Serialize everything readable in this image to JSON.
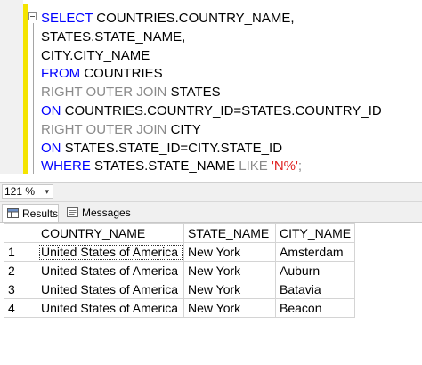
{
  "editor": {
    "lines": [
      [
        {
          "t": "SELECT COUNTRIES.COUNTRY_NAME,",
          "c": "kw-mixed"
        }
      ],
      [
        {
          "t": "STATES.STATE_NAME,",
          "c": ""
        }
      ],
      [
        {
          "t": "CITY.CITY_NAME",
          "c": ""
        }
      ],
      [
        {
          "t": "FROM",
          "c": "kw"
        },
        {
          "t": " COUNTRIES",
          "c": ""
        }
      ],
      [
        {
          "t": "RIGHT OUTER JOIN",
          "c": "gr"
        },
        {
          "t": " STATES",
          "c": ""
        }
      ],
      [
        {
          "t": "ON",
          "c": "kw"
        },
        {
          "t": " COUNTRIES.COUNTRY_ID=STATES.COUNTRY_ID",
          "c": ""
        }
      ],
      [
        {
          "t": "RIGHT OUTER JOIN",
          "c": "gr"
        },
        {
          "t": " CITY",
          "c": ""
        }
      ],
      [
        {
          "t": "ON",
          "c": "kw"
        },
        {
          "t": " STATES.STATE_ID=CITY.STATE_ID",
          "c": ""
        }
      ],
      [
        {
          "t": "WHERE",
          "c": "kw"
        },
        {
          "t": " STATES.STATE_NAME ",
          "c": ""
        },
        {
          "t": "LIKE",
          "c": "gr"
        },
        {
          "t": " ",
          "c": ""
        },
        {
          "t": "'N%'",
          "c": "st"
        },
        {
          "t": ";",
          "c": "gr"
        }
      ]
    ]
  },
  "zoom": {
    "value": "121 %",
    "arrow": "▾"
  },
  "tabs": {
    "results": "Results",
    "messages": "Messages"
  },
  "grid": {
    "columns": [
      "COUNTRY_NAME",
      "STATE_NAME",
      "CITY_NAME"
    ],
    "rows": [
      {
        "num": "1",
        "cells": [
          "United States of America",
          "New York",
          "Amsterdam"
        ]
      },
      {
        "num": "2",
        "cells": [
          "United States of America",
          "New York",
          "Auburn"
        ]
      },
      {
        "num": "3",
        "cells": [
          "United States of America",
          "New York",
          "Batavia"
        ]
      },
      {
        "num": "4",
        "cells": [
          "United States of America",
          "New York",
          "Beacon"
        ]
      }
    ]
  }
}
